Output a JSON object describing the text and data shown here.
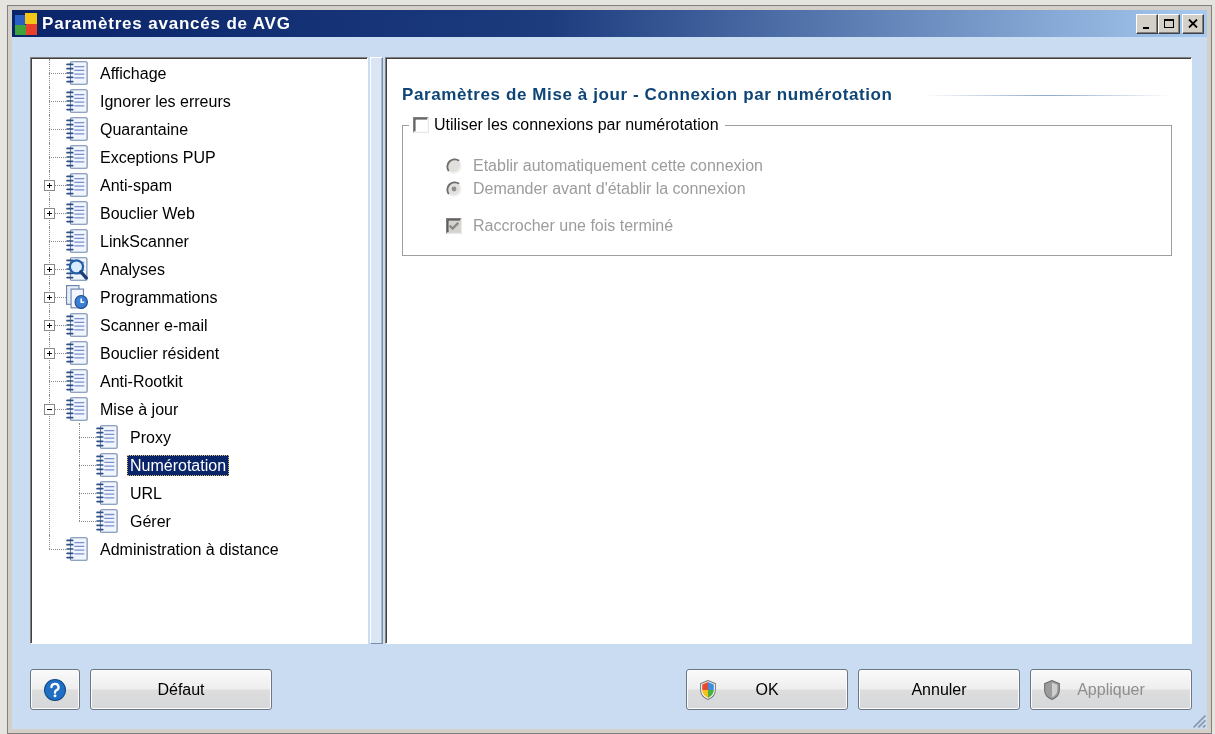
{
  "window": {
    "title": "Paramètres avancés de AVG"
  },
  "tree": {
    "items": [
      {
        "label": "Affichage",
        "kind": "page",
        "selected": false
      },
      {
        "label": "Ignorer les erreurs",
        "kind": "page",
        "selected": false
      },
      {
        "label": "Quarantaine",
        "kind": "page",
        "selected": false
      },
      {
        "label": "Exceptions PUP",
        "kind": "page",
        "selected": false
      },
      {
        "label": "Anti-spam",
        "kind": "page",
        "expanded": false,
        "selected": false
      },
      {
        "label": "Bouclier Web",
        "kind": "page",
        "expanded": false,
        "selected": false
      },
      {
        "label": "LinkScanner",
        "kind": "page",
        "selected": false
      },
      {
        "label": "Analyses",
        "kind": "scan",
        "expanded": false,
        "selected": false
      },
      {
        "label": "Programmations",
        "kind": "schedule",
        "expanded": false,
        "selected": false
      },
      {
        "label": "Scanner e-mail",
        "kind": "page",
        "expanded": false,
        "selected": false
      },
      {
        "label": "Bouclier résident",
        "kind": "page",
        "expanded": false,
        "selected": false
      },
      {
        "label": "Anti-Rootkit",
        "kind": "page",
        "selected": false
      },
      {
        "label": "Mise à jour",
        "kind": "page",
        "expanded": true,
        "selected": false,
        "children": [
          {
            "label": "Proxy",
            "kind": "page",
            "selected": false
          },
          {
            "label": "Numérotation",
            "kind": "page",
            "selected": true
          },
          {
            "label": "URL",
            "kind": "page",
            "selected": false
          },
          {
            "label": "Gérer",
            "kind": "page",
            "selected": false
          }
        ]
      },
      {
        "label": "Administration à distance",
        "kind": "page",
        "selected": false
      }
    ]
  },
  "panel": {
    "heading": "Paramètres de Mise à jour - Connexion par numérotation",
    "group": {
      "label": "Utiliser les connexions par numérotation",
      "checked": false,
      "options": [
        {
          "label": "Etablir automatiquement cette connexion",
          "selected": false,
          "disabled": true
        },
        {
          "label": "Demander avant d'établir la connexion",
          "selected": true,
          "disabled": true
        }
      ],
      "hangup": {
        "label": "Raccrocher une fois terminé",
        "checked": true,
        "disabled": true
      }
    }
  },
  "footer": {
    "left": [
      {
        "kind": "help",
        "disabled": false
      },
      {
        "kind": "plain",
        "label": "Défaut",
        "disabled": false
      }
    ],
    "right": [
      {
        "kind": "shield",
        "label": "OK",
        "disabled": false
      },
      {
        "kind": "plain",
        "label": "Annuler",
        "disabled": false
      },
      {
        "kind": "shield",
        "label": "Appliquer",
        "disabled": true
      }
    ]
  }
}
